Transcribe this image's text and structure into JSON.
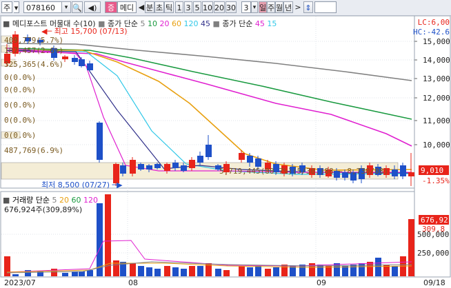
{
  "toolbar": {
    "type_label": "주",
    "code": "078160",
    "view_btn": "증",
    "name": "메디",
    "period_mode": "분",
    "period_tick": "초",
    "period_tick2": "틱",
    "periods": [
      "1",
      "3",
      "5",
      "10",
      "20",
      "30"
    ],
    "count": "3",
    "day": "일",
    "week": "주",
    "month": "월",
    "year": "년"
  },
  "legend": {
    "title": "메디포스트 머물대 수(10)",
    "ma_label": "종가 단순",
    "ma_periods": [
      "5",
      "10",
      "20",
      "60",
      "120",
      "45"
    ],
    "ma_label2": "종가 단순",
    "ma2_periods": [
      "45",
      "15"
    ]
  },
  "lc_hc": {
    "lc": "LC:6,00",
    "hc": "HC:-42.6"
  },
  "price_axis": [
    "15,000",
    "14,000",
    "13,000",
    "12,000",
    "11,000",
    "10,000",
    "9,010"
  ],
  "current": {
    "price": "9,010",
    "change": "-1.35%"
  },
  "annotations": {
    "high": "최고 15,700 (07/13)",
    "low": "최저 8,500 (07/27)",
    "vp": [
      "409,779(5.7%)",
      "187,457(2.6%)",
      "325,365(4.6%)",
      "0(0.0%)",
      "0(0.0%)",
      "0(0.0%)",
      "0(0.0%)",
      "0(0.0%)",
      "487,769(6.9%)",
      "5,719,445(80.7%)(5/30,)88 ~ 8,730/08)"
    ]
  },
  "volume": {
    "legend_label": "거래량 단순",
    "legend_periods": [
      "5",
      "20",
      "60",
      "120"
    ],
    "current": "676,924주(309,89%)",
    "axis": [
      "676,92",
      "309,8",
      "500,000",
      "250,000"
    ]
  },
  "date_axis": [
    "2023/07",
    "08",
    "09",
    "09/18"
  ],
  "colors": {
    "up": "#e8241a",
    "down": "#1e50c8",
    "ma5": "#808080",
    "ma10": "#1a9a40",
    "ma20": "#e020d0",
    "ma60": "#e8a010",
    "ma120": "#30c8e8",
    "ma45": "#30308a"
  }
}
